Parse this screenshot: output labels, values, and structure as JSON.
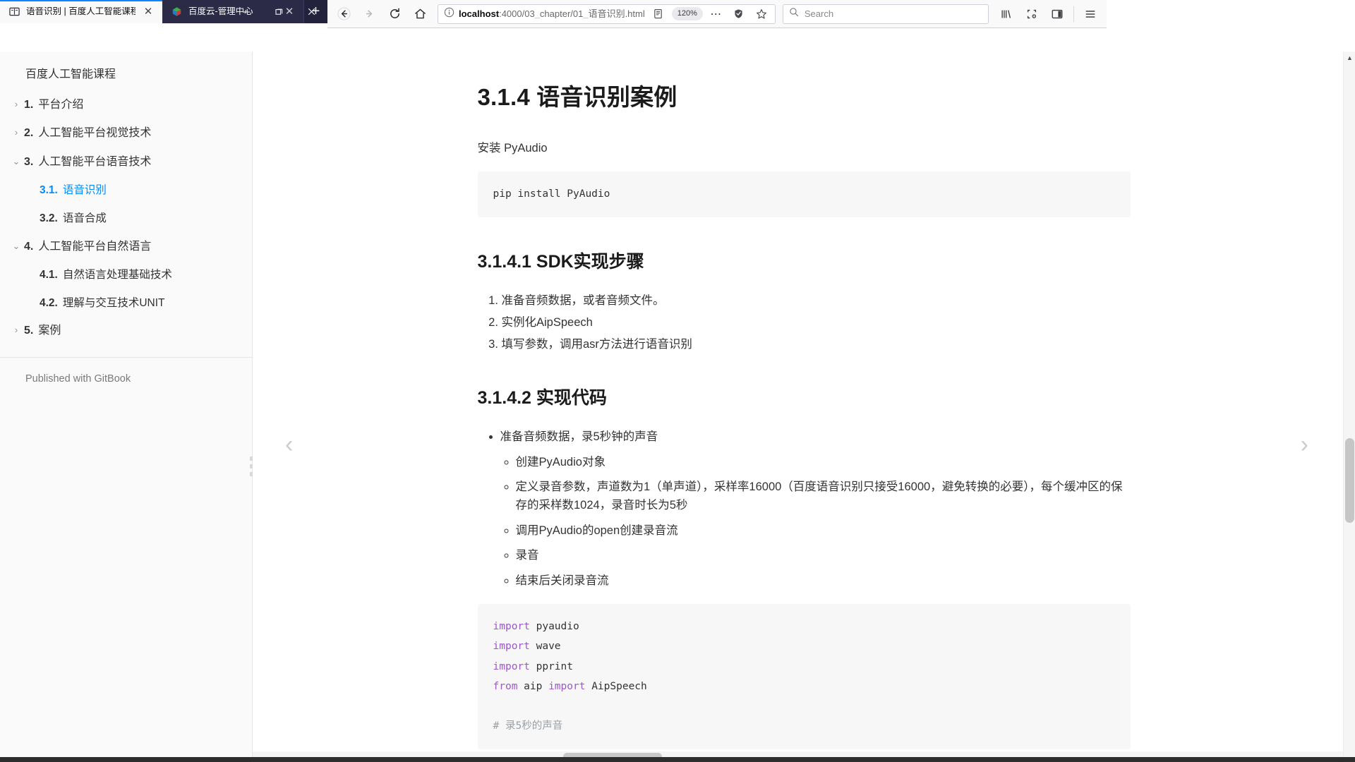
{
  "browser": {
    "tabs": [
      {
        "title": "语音识别 | 百度人工智能课程",
        "favicon": "book-icon",
        "active": false,
        "close_label": "✕"
      },
      {
        "title": "百度云-管理中心",
        "favicon": "baidu-cloud-icon",
        "active": true,
        "close_label": "✕"
      }
    ],
    "new_tab_label": "+",
    "window_controls": {
      "minimize": "—",
      "restore": "❐",
      "close": "✕"
    },
    "toolbar": {
      "back_label": "←",
      "forward_label": "→",
      "reload_label": "⟳",
      "home_label": "⌂",
      "url_host": "localhost",
      "url_rest": ":4000/03_chapter/01_语音识别.html",
      "url_full": "localhost:4000/03_chapter/01_语音识别.html",
      "site_info_icon": "info-circle-icon",
      "reader_icon": "reader-view-icon",
      "zoom_level": "120%",
      "page_actions_label": "⋯",
      "shield_icon": "shield-icon",
      "bookmark_icon": "star-icon",
      "library_icon": "library-icon",
      "clip_icon": "pocket-clip-icon",
      "sidebar_icon": "sidebar-toggle-icon",
      "menu_icon": "hamburger-menu-icon"
    },
    "search": {
      "placeholder": "Search",
      "value": "",
      "icon": "search-icon"
    }
  },
  "sidebar": {
    "book_title": "百度人工智能课程",
    "footer": "Published with GitBook",
    "items": [
      {
        "caret": "›",
        "num": "1.",
        "label": "平台介绍",
        "level": 1,
        "active": false
      },
      {
        "caret": "›",
        "num": "2.",
        "label": "人工智能平台视觉技术",
        "level": 1,
        "active": false
      },
      {
        "caret": "⌄",
        "num": "3.",
        "label": "人工智能平台语音技术",
        "level": 1,
        "active": false
      },
      {
        "caret": "",
        "num": "3.1.",
        "label": "语音识别",
        "level": 2,
        "active": true
      },
      {
        "caret": "",
        "num": "3.2.",
        "label": "语音合成",
        "level": 2,
        "active": false
      },
      {
        "caret": "⌄",
        "num": "4.",
        "label": "人工智能平台自然语言",
        "level": 1,
        "active": false
      },
      {
        "caret": "",
        "num": "4.1.",
        "label": "自然语言处理基础技术",
        "level": 2,
        "active": false
      },
      {
        "caret": "",
        "num": "4.2.",
        "label": "理解与交互技术UNIT",
        "level": 2,
        "active": false
      },
      {
        "caret": "›",
        "num": "5.",
        "label": "案例",
        "level": 1,
        "active": false
      }
    ]
  },
  "page": {
    "h1": "3.1.4 语音识别案例",
    "intro": "安装 PyAudio",
    "install_code": "pip install PyAudio",
    "h2_steps": "3.1.4.1 SDK实现步骤",
    "steps": [
      "准备音频数据，或者音频文件。",
      "实例化AipSpeech",
      "填写参数，调用asr方法进行语音识别"
    ],
    "h2_code": "3.1.4.2 实现代码",
    "bullet_main": "准备音频数据，录5秒钟的声音",
    "bullet_subs": [
      "创建PyAudio对象",
      "定义录音参数，声道数为1（单声道），采样率16000（百度语音识别只接受16000，避免转换的必要），每个缓冲区的保存的采样数1024，录音时长为5秒",
      "调用PyAudio的open创建录音流",
      "录音",
      "结束后关闭录音流"
    ],
    "code_lines": [
      {
        "kw": "import",
        "rest": " pyaudio"
      },
      {
        "kw": "import",
        "rest": " wave"
      },
      {
        "kw": "import",
        "rest": " pprint"
      },
      {
        "kw": "from",
        "rest": " aip ",
        "kw2": "import",
        "rest2": " AipSpeech"
      },
      {
        "blank": true
      },
      {
        "comment": "# 录5秒的声音"
      }
    ],
    "prev_label": "‹",
    "next_label": "›"
  }
}
